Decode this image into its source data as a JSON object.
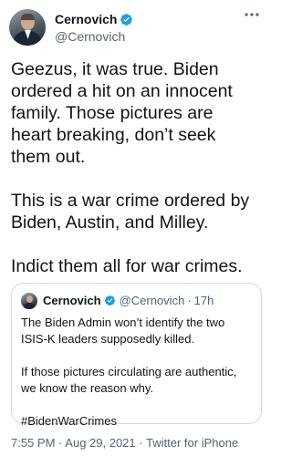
{
  "tweet": {
    "author": {
      "display_name": "Cernovich",
      "handle": "@Cernovich",
      "avatar_icon": "profile-photo",
      "verified_icon": "verified-badge-icon"
    },
    "more_icon": "more-options-icon",
    "text_lines": [
      [
        "Geezus, it was true. Biden",
        "ordered a hit on an innocent",
        "family. Those pictures are",
        "heart breaking, don’t seek",
        "them out."
      ],
      [
        "This is a war crime ordered by",
        "Biden, Austin, and Milley."
      ],
      [
        "Indict them all for war crimes."
      ]
    ],
    "quoted": {
      "display_name": "Cernovich",
      "handle": "@Cernovich",
      "separator": "·",
      "time": "17h",
      "text_lines": [
        [
          "The Biden Admin won’t identify the two",
          "ISIS-K leaders supposedly killed."
        ],
        [
          "If those pictures circulating are authentic,",
          "we know the reason why."
        ],
        [
          "#BidenWarCrimes"
        ]
      ]
    },
    "meta": {
      "time": "7:55 PM",
      "separator": "·",
      "date": "Aug 29, 2021",
      "source": "Twitter for iPhone"
    },
    "colors": {
      "text": "#0f1419",
      "secondary": "#536471",
      "verified": "#1d9bf0",
      "border": "#cfd9de"
    }
  }
}
